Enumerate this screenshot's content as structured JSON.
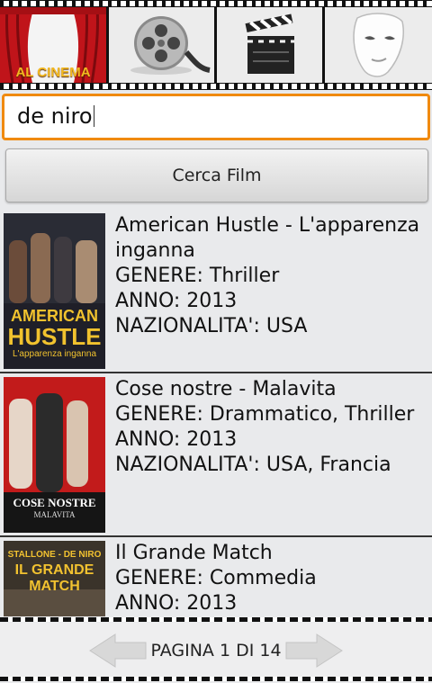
{
  "header": {
    "tabs": [
      {
        "label": "AL CINEMA",
        "icon": "curtain-icon"
      },
      {
        "label": "",
        "icon": "film-reel-icon"
      },
      {
        "label": "",
        "icon": "clapperboard-icon"
      },
      {
        "label": "",
        "icon": "mask-icon"
      }
    ]
  },
  "search": {
    "value": "de niro"
  },
  "search_button": {
    "label": "Cerca Film"
  },
  "results": [
    {
      "title": "American Hustle - L'apparenza inganna",
      "title_line1": "American Hustle - L'apparenza",
      "title_line2": "inganna",
      "genre": "GENERE: Thriller",
      "year": "ANNO: 2013",
      "country": "NAZIONALITA': USA",
      "poster_text": [
        "AMERICAN",
        "HUSTLE",
        "L'apparenza inganna"
      ]
    },
    {
      "title": "Cose nostre - Malavita",
      "genre": "GENERE: Drammatico, Thriller",
      "year": "ANNO: 2013",
      "country": "NAZIONALITA': USA, Francia",
      "poster_text": [
        "COSE NOSTRE",
        "MALAVITA"
      ]
    },
    {
      "title": "Il Grande Match",
      "genre": "GENERE: Commedia",
      "year": "ANNO: 2013",
      "poster_text": [
        "STALLONE",
        "DE NIRO",
        "IL GRANDE MATCH"
      ]
    }
  ],
  "pagination": {
    "label": "PAGINA 1 DI 14",
    "prev_icon": "arrow-left-icon",
    "next_icon": "arrow-right-icon"
  },
  "colors": {
    "accent": "#f08a10",
    "background": "#e9eaec"
  }
}
